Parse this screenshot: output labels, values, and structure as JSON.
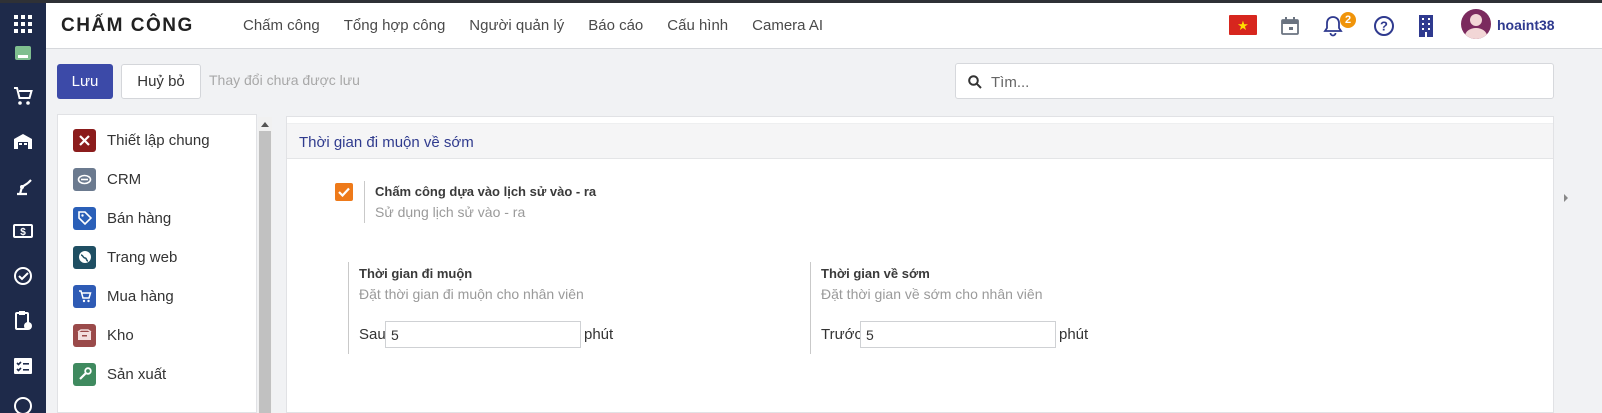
{
  "app": {
    "title": "CHẤM CÔNG"
  },
  "menu": {
    "items": [
      {
        "label": "Chấm công"
      },
      {
        "label": "Tổng hợp công"
      },
      {
        "label": "Người quản lý"
      },
      {
        "label": "Báo cáo"
      },
      {
        "label": "Cấu hình"
      },
      {
        "label": "Camera AI"
      }
    ]
  },
  "navbar": {
    "notification_count": "2",
    "username": "hoaint38",
    "icons": [
      "language-flag-icon",
      "calendar-icon",
      "bell-icon",
      "help-icon",
      "company-building-icon"
    ]
  },
  "toolbar": {
    "save_label": "Lưu",
    "cancel_label": "Huỷ bỏ",
    "unsaved_text": "Thay đổi chưa được lưu",
    "search_placeholder": "Tìm..."
  },
  "sidebar": {
    "items": [
      {
        "label": "Thiết lập chung",
        "icon": "tools-icon",
        "color": "#8b1c1c"
      },
      {
        "label": "CRM",
        "icon": "handshake-icon",
        "color": "#6b7a8f"
      },
      {
        "label": "Bán hàng",
        "icon": "tag-icon",
        "color": "#2a5fb8"
      },
      {
        "label": "Trang web",
        "icon": "globe-icon",
        "color": "#1f4f63"
      },
      {
        "label": "Mua hàng",
        "icon": "cart-icon",
        "color": "#2e5bb5"
      },
      {
        "label": "Kho",
        "icon": "box-icon",
        "color": "#9a4a4a"
      },
      {
        "label": "Sản xuất",
        "icon": "wrench-icon",
        "color": "#3f8a5f"
      }
    ]
  },
  "section": {
    "title": "Thời gian đi muộn về sớm",
    "history_setting": {
      "title": "Chấm công dựa vào lịch sử vào - ra",
      "description": "Sử dụng lịch sử vào - ra",
      "checked": true
    },
    "late_setting": {
      "title": "Thời gian đi muộn",
      "description": "Đặt thời gian đi muộn cho nhân viên",
      "prefix": "Sau",
      "value": "5",
      "unit": "phút"
    },
    "early_setting": {
      "title": "Thời gian về sớm",
      "description": "Đặt thời gian về sớm cho nhân viên",
      "prefix": "Trước",
      "value": "5",
      "unit": "phút"
    }
  },
  "colors": {
    "primary": "#3c4aa8",
    "rail": "#1e2a4a",
    "checkbox": "#ee7a1a",
    "badge": "#f0940a",
    "section_title": "#303b8e"
  }
}
